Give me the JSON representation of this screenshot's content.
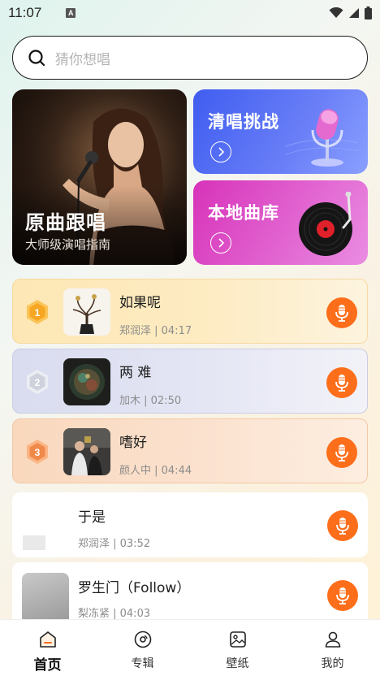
{
  "status_bar": {
    "time": "11:07",
    "notif_letter": "A"
  },
  "search": {
    "placeholder": "猜你想唱"
  },
  "hero": {
    "title": "原曲跟唱",
    "subtitle": "大师级演唱指南"
  },
  "cards": [
    {
      "title": "清唱挑战",
      "color": "#4f6cf2"
    },
    {
      "title": "本地曲库",
      "color": "#d93bbd"
    }
  ],
  "ranking": [
    {
      "rank": "1",
      "title": "如果呢",
      "meta": "郑润泽 | 04:17"
    },
    {
      "rank": "2",
      "title": "两 难",
      "meta": "加木 | 02:50"
    },
    {
      "rank": "3",
      "title": "嗜好",
      "meta": "颜人中 | 04:44"
    }
  ],
  "songs": [
    {
      "title": "于是",
      "meta": "郑润泽 | 03:52"
    },
    {
      "title": "罗生门（Follow）",
      "meta": "梨冻紧 | 04:03"
    }
  ],
  "nav": [
    {
      "label": "首页",
      "icon": "home-icon",
      "active": true
    },
    {
      "label": "专辑",
      "icon": "album-icon",
      "active": false
    },
    {
      "label": "壁纸",
      "icon": "wallpaper-icon",
      "active": false
    },
    {
      "label": "我的",
      "icon": "profile-icon",
      "active": false
    }
  ],
  "colors": {
    "accent": "#fd6e1b",
    "gold": "#f5a524",
    "silver": "#cfd2dc",
    "bronze": "#f08a4b"
  }
}
